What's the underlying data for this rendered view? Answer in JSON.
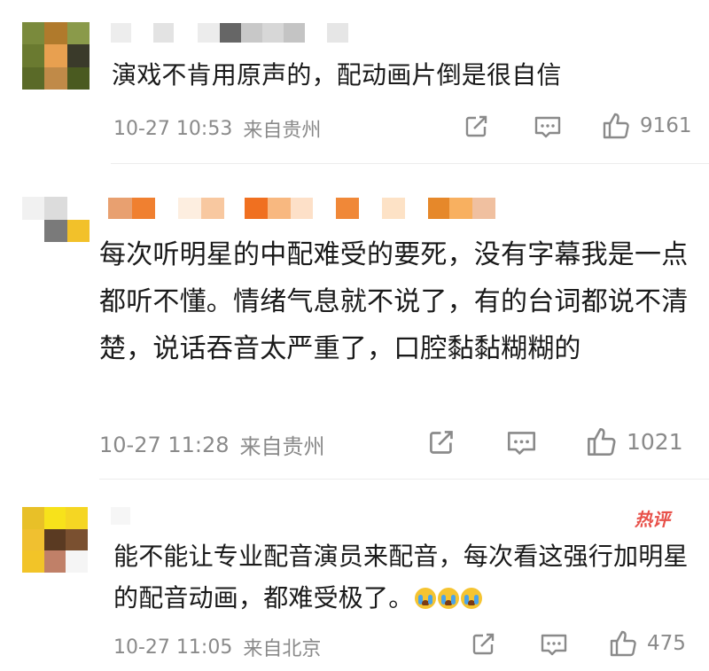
{
  "comments": [
    {
      "text": "演戏不肯用原声的，配动画片倒是很自信",
      "time": "10-27 10:53",
      "location": "来自贵州",
      "likes": "9161",
      "hot_badge": ""
    },
    {
      "text": "每次听明星的中配难受的要死，没有字幕我是一点都听不懂。情绪气息就不说了，有的台词都说不清楚，说话吞音太严重了，口腔黏黏糊糊的",
      "time": "10-27 11:28",
      "location": "来自贵州",
      "likes": "1021",
      "hot_badge": ""
    },
    {
      "text": "能不能让专业配音演员来配音，每次看这强行加明星的配音动画，都难受极了。",
      "time": "10-27 11:05",
      "location": "来自北京",
      "likes": "475",
      "hot_badge": "热评"
    }
  ],
  "icons": {
    "share": "share-icon",
    "comment": "comment-icon",
    "like": "thumbs-up-icon",
    "emoji": "loudly-crying-face-icon"
  },
  "colors": {
    "hot_badge": "#e8514a",
    "meta_text": "#8a8a8a",
    "body_text": "#1a1a1a"
  }
}
